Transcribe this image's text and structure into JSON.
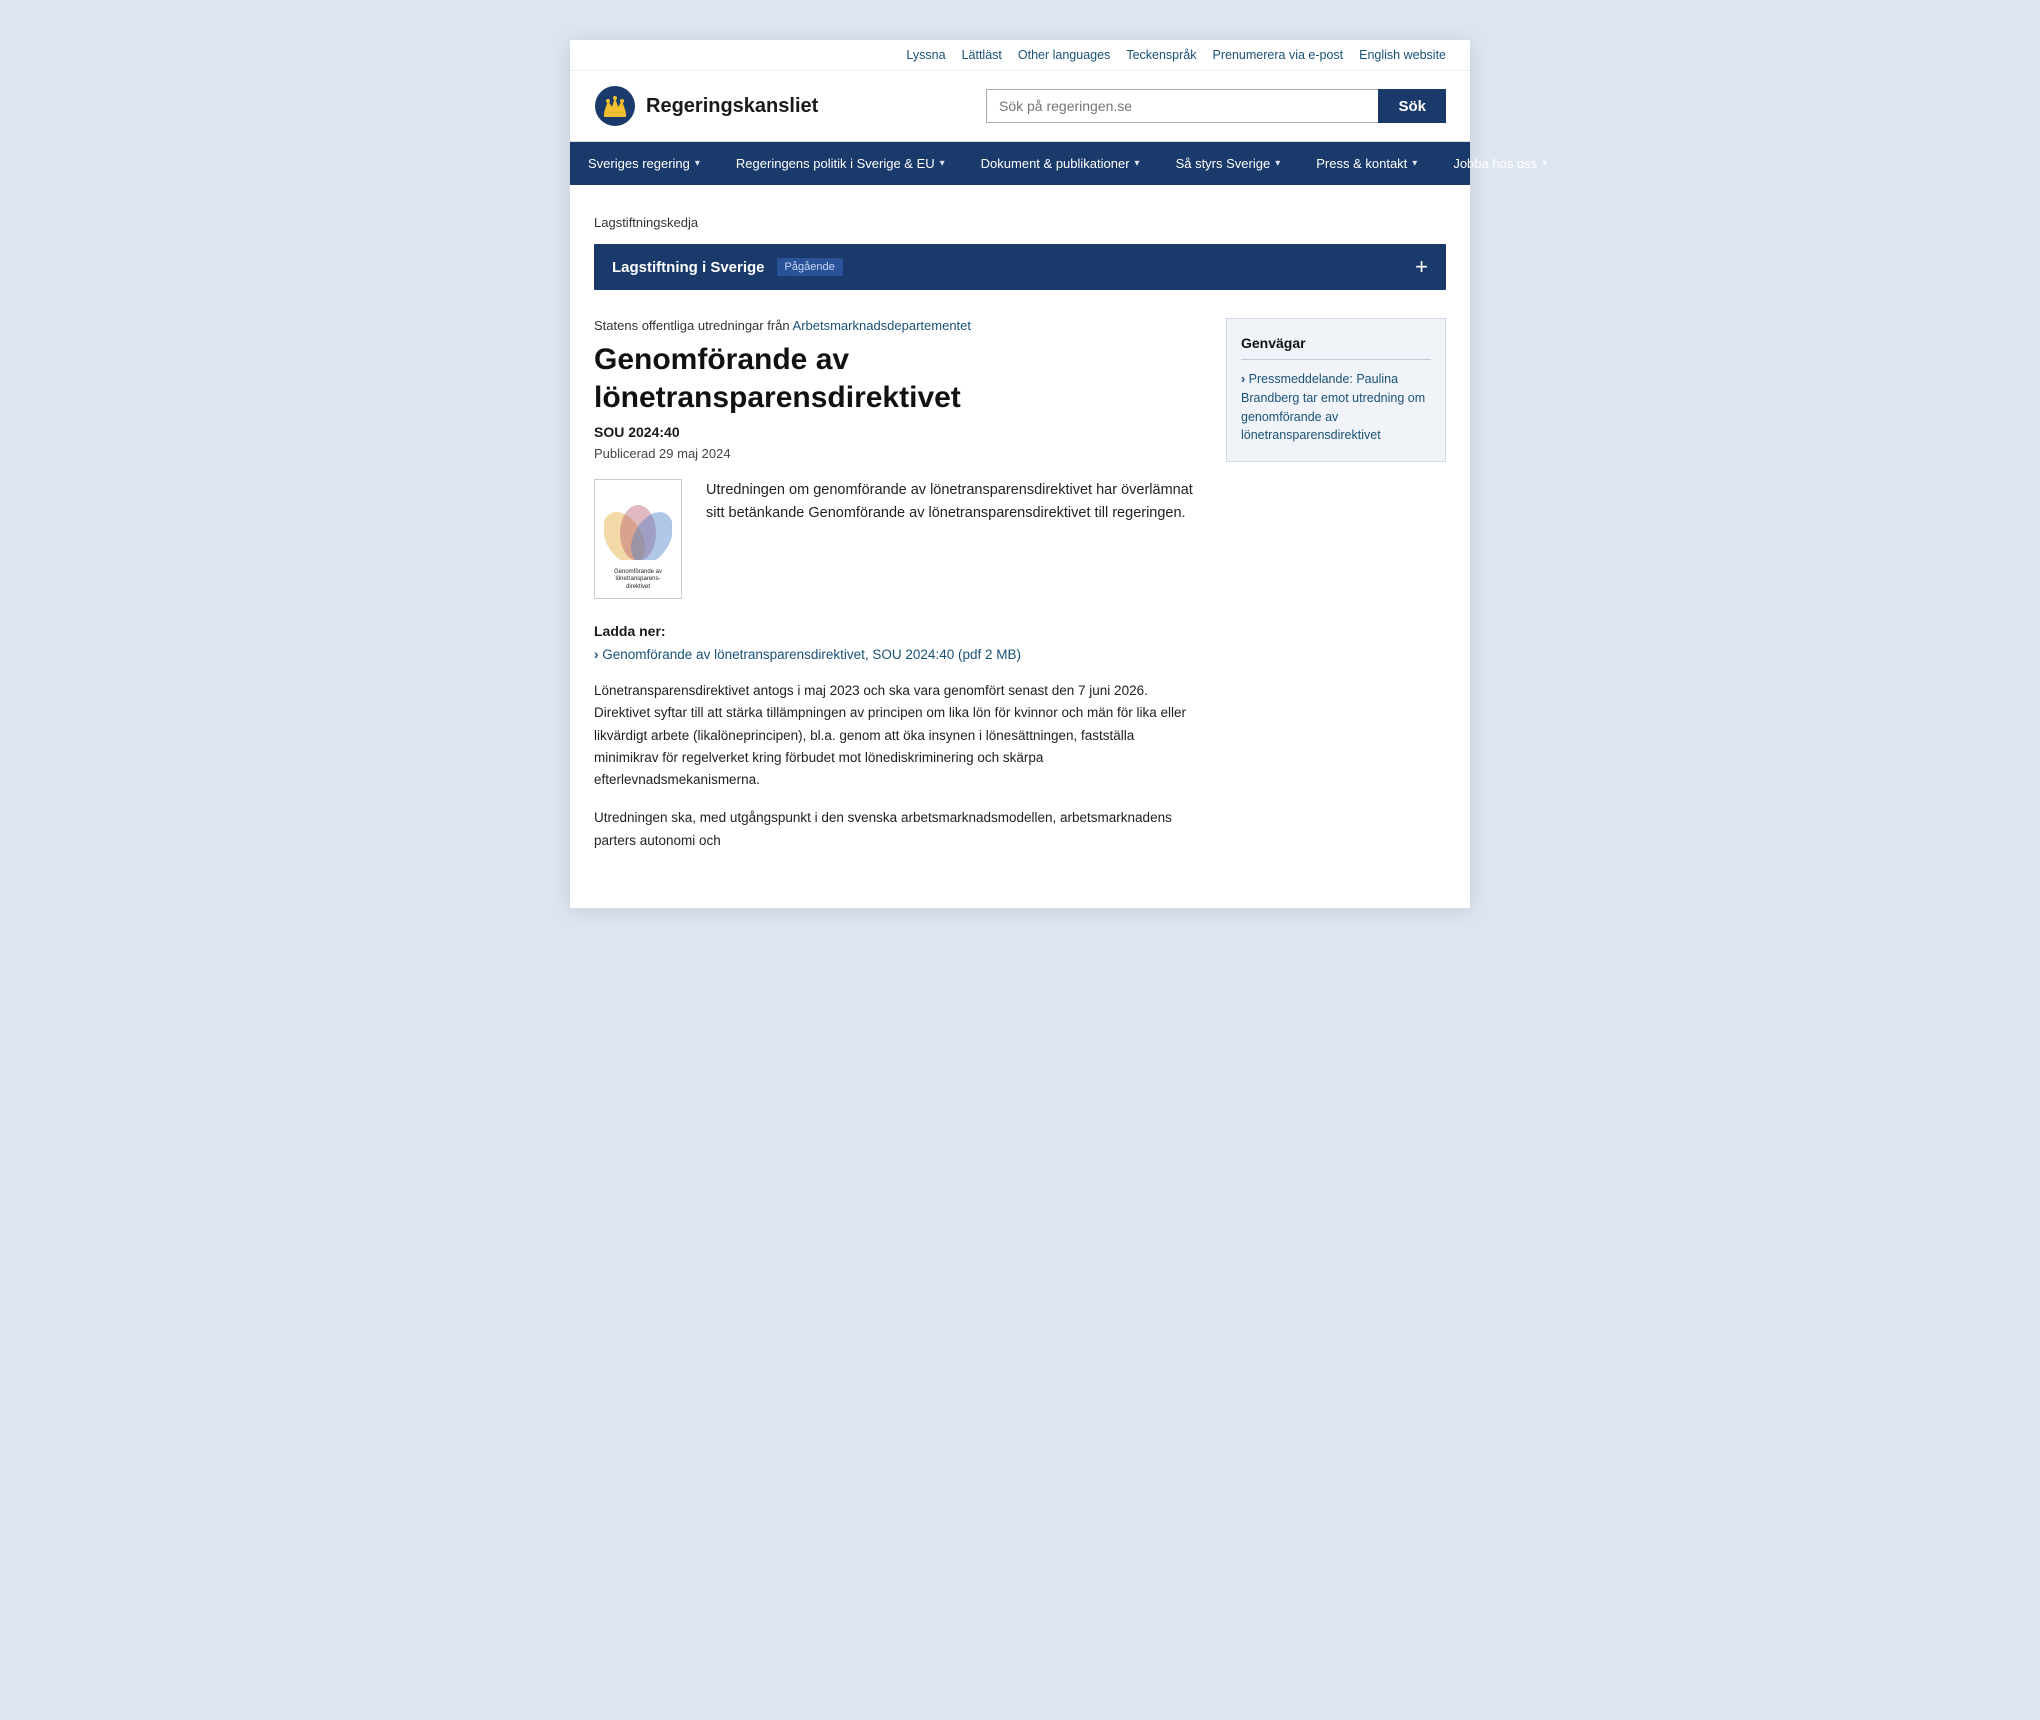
{
  "topbar": {
    "links": [
      {
        "label": "Lyssna",
        "id": "lyssna"
      },
      {
        "label": "Lättläst",
        "id": "lattlast"
      },
      {
        "label": "Other languages",
        "id": "other-languages"
      },
      {
        "label": "Teckenspråk",
        "id": "tecksprak"
      },
      {
        "label": "Prenumerera via e-post",
        "id": "prenumerera"
      },
      {
        "label": "English website",
        "id": "english-website"
      }
    ]
  },
  "header": {
    "logo_text": "Regeringskansliet",
    "search_placeholder": "Sök på regeringen.se",
    "search_button": "Sök"
  },
  "nav": {
    "items": [
      {
        "label": "Sveriges regering",
        "has_dropdown": true
      },
      {
        "label": "Regeringens politik i Sverige & EU",
        "has_dropdown": true
      },
      {
        "label": "Dokument & publikationer",
        "has_dropdown": true
      },
      {
        "label": "Så styrs Sverige",
        "has_dropdown": true
      },
      {
        "label": "Press & kontakt",
        "has_dropdown": true
      },
      {
        "label": "Jobba hos oss",
        "has_dropdown": true
      }
    ]
  },
  "breadcrumb": {
    "label": "Lagstiftningskedja"
  },
  "legislation_bar": {
    "title": "Lagstiftning i Sverige",
    "badge": "Pågående",
    "expand_icon": "+"
  },
  "article": {
    "meta_prefix": "Statens offentliga utredningar från",
    "meta_link_text": "Arbetsmarknadsdepartementet",
    "title": "Genomförande av lönetransparensdirektivet",
    "sou": "SOU 2024:40",
    "date_label": "Publicerad 29 maj 2024",
    "intro": "Utredningen om genomförande av lönetransparensdirektivet har överlämnat sitt betänkande Genomförande av lönetransparensdirektivet till regeringen.",
    "download_label": "Ladda ner:",
    "download_link": "Genomförande av lönetransparensdirektivet, SOU 2024:40 (pdf 2 MB)",
    "body_p1": "Lönetransparensdirektivet antogs i maj 2023 och ska vara genomfört senast den 7 juni 2026. Direktivet syftar till att stärka tillämpningen av principen om lika lön för kvinnor och män för lika eller likvärdigt arbete (likalöneprincipen), bl.a. genom att öka insynen i lönesättningen, fastställa minimikrav för regelverket kring förbudet mot lönediskriminering och skärpa efterlevnadsmekanismerna.",
    "body_p2": "Utredningen ska, med utgångspunkt i den svenska arbetsmarknadsmodellen, arbetsmarknadens parters autonomi och"
  },
  "sidebar": {
    "title": "Genvägar",
    "link_text": "Pressmeddelande: Paulina Brandberg tar emot utredning om genomförande av lönetransparensdirektivet"
  },
  "book_cover": {
    "title_line1": "Genomförande av",
    "title_line2": "lönetransparens-",
    "title_line3": "direktivet"
  }
}
